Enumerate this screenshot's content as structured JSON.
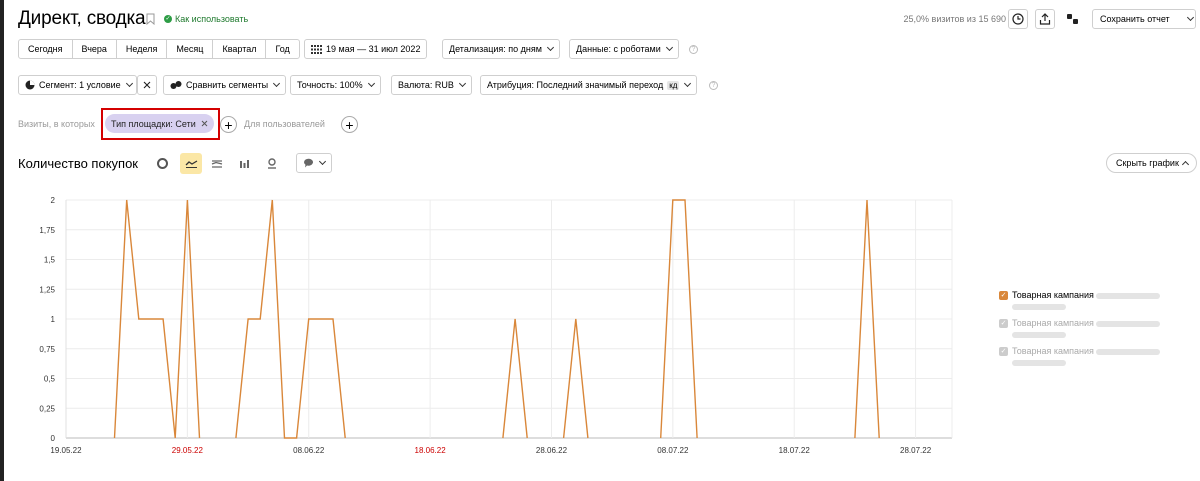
{
  "header": {
    "title": "Директ, сводка",
    "how_to": "Как использовать",
    "visits_info": "25,0% визитов из 15 690",
    "save_report": "Сохранить отчет"
  },
  "periods": [
    "Сегодня",
    "Вчера",
    "Неделя",
    "Месяц",
    "Квартал",
    "Год"
  ],
  "date_range": "19 мая — 31 июл 2022",
  "detail": "Детализация: по дням",
  "data_filter": "Данные: с роботами",
  "toolbar2": {
    "segment": "Сегмент: 1 условие",
    "compare": "Сравнить сегменты",
    "accuracy": "Точность: 100%",
    "currency": "Валюта: RUB",
    "attribution": "Атрибуция: Последний значимый переход",
    "attribution_badge": "кд"
  },
  "filters": {
    "visits_label": "Визиты, в которых",
    "chip": "Тип площадки: Сети",
    "users_label": "Для пользователей"
  },
  "chart_header": {
    "title": "Количество покупок",
    "hide_chart": "Скрыть график",
    "chart_types": [
      "pie-chart-icon",
      "line-chart-icon",
      "area-chart-icon",
      "bar-chart-icon",
      "map-icon"
    ],
    "active_type": "line-chart-icon"
  },
  "legend": [
    {
      "label": "Товарная кампания",
      "checked": true,
      "color": "#d9873a"
    },
    {
      "label": "Товарная кампания",
      "checked": true,
      "color": "#cccccc"
    },
    {
      "label": "Товарная кампания",
      "checked": true,
      "color": "#cccccc"
    }
  ],
  "colors": {
    "series": "#d9873a",
    "holiday": "#cc0000",
    "chip_bg": "#d8d1f0",
    "highlight_border": "#d40000",
    "active_tool": "#fbe7a6"
  },
  "chart_data": {
    "type": "line",
    "title": "Количество покупок",
    "x_tick_labels": [
      "19.05.22",
      "29.05.22",
      "08.06.22",
      "18.06.22",
      "28.06.22",
      "08.07.22",
      "18.07.22",
      "28.07.22"
    ],
    "x_tick_red": [
      false,
      true,
      false,
      true,
      false,
      false,
      false,
      false
    ],
    "y_tick_labels": [
      "0",
      "0,25",
      "0,5",
      "0,75",
      "1",
      "1,25",
      "1,5",
      "1,75",
      "2"
    ],
    "ylim": [
      0,
      2
    ],
    "x_start": "2022-05-19",
    "x_end": "2022-07-31",
    "grid": true,
    "legend_position": "right",
    "series": [
      {
        "name": "Товарная кампания",
        "color": "#d9873a",
        "points": [
          [
            "2022-05-23",
            0
          ],
          [
            "2022-05-24",
            2
          ],
          [
            "2022-05-25",
            1
          ],
          [
            "2022-05-26",
            1
          ],
          [
            "2022-05-27",
            1
          ],
          [
            "2022-05-28",
            0
          ],
          [
            "2022-05-29",
            2
          ],
          [
            "2022-05-30",
            0
          ],
          [
            "2022-06-02",
            0
          ],
          [
            "2022-06-03",
            1
          ],
          [
            "2022-06-04",
            1
          ],
          [
            "2022-06-05",
            2
          ],
          [
            "2022-06-06",
            0
          ],
          [
            "2022-06-07",
            0
          ],
          [
            "2022-06-08",
            1
          ],
          [
            "2022-06-09",
            1
          ],
          [
            "2022-06-10",
            1
          ],
          [
            "2022-06-11",
            0
          ],
          [
            "2022-06-24",
            0
          ],
          [
            "2022-06-25",
            1
          ],
          [
            "2022-06-26",
            0
          ],
          [
            "2022-06-29",
            0
          ],
          [
            "2022-06-30",
            1
          ],
          [
            "2022-07-01",
            0
          ],
          [
            "2022-07-07",
            0
          ],
          [
            "2022-07-08",
            2
          ],
          [
            "2022-07-09",
            2
          ],
          [
            "2022-07-10",
            0
          ],
          [
            "2022-07-23",
            0
          ],
          [
            "2022-07-24",
            2
          ],
          [
            "2022-07-25",
            0
          ]
        ]
      }
    ]
  }
}
